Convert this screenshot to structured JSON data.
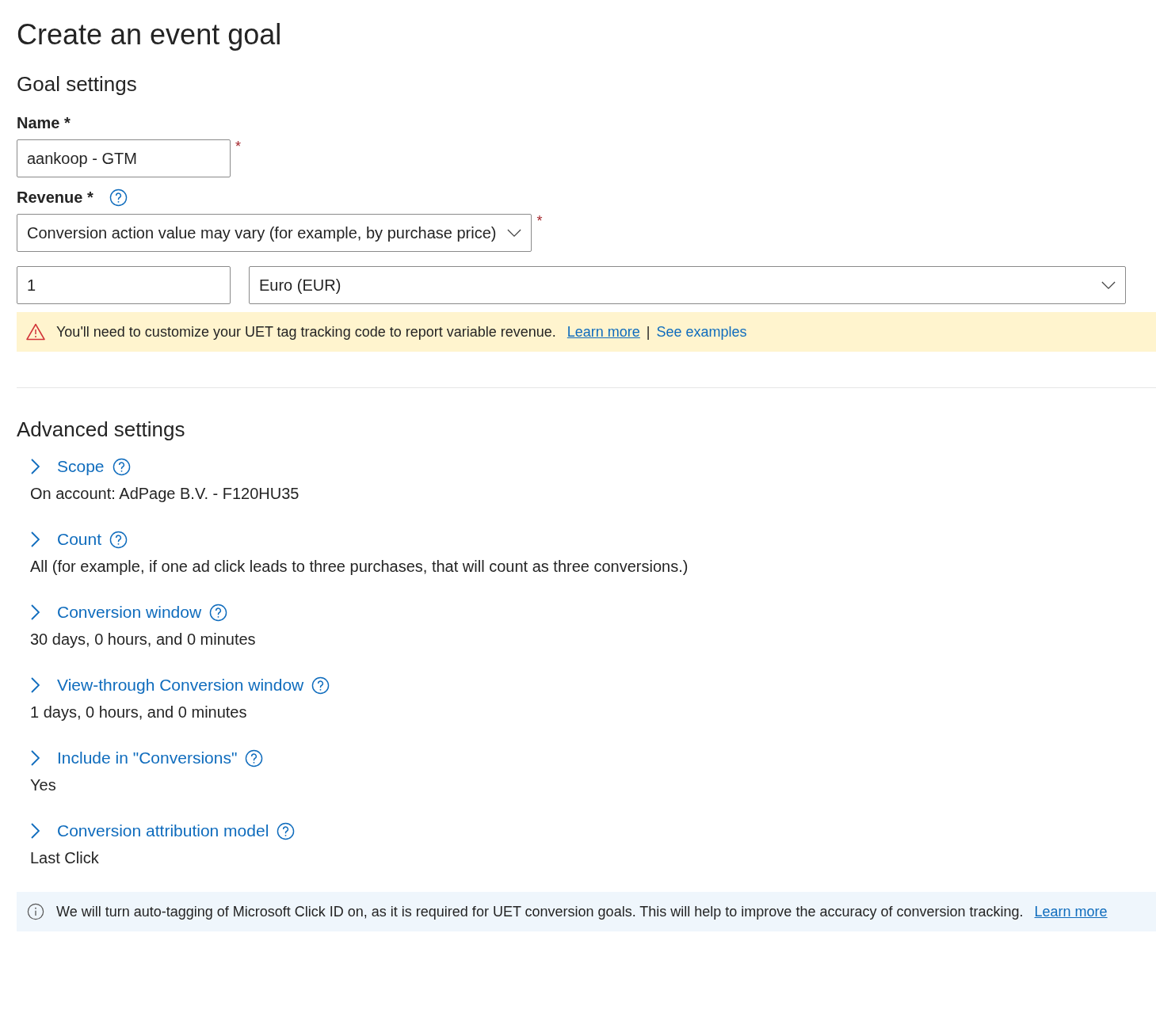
{
  "page": {
    "title": "Create an event goal"
  },
  "goal_settings": {
    "heading": "Goal settings",
    "name": {
      "label": "Name *",
      "value": "aankoop - GTM",
      "required_mark": "*"
    },
    "revenue": {
      "label": "Revenue *",
      "dropdown": {
        "value": "Conversion action value may vary (for example, by purchase price)",
        "required_mark": "*"
      },
      "amount": {
        "value": "1"
      },
      "currency": {
        "value": "Euro (EUR)"
      }
    },
    "warning": {
      "text": "You'll need to customize your UET tag tracking code to report variable revenue.",
      "links": [
        {
          "label": "Learn more",
          "underlined": true
        },
        {
          "label": "See examples",
          "underlined": false
        }
      ],
      "separator": "|"
    }
  },
  "advanced_settings": {
    "heading": "Advanced settings",
    "items": [
      {
        "label": "Scope",
        "expanded": false,
        "summary": "On account: AdPage B.V. - F120HU35"
      },
      {
        "label": "Count",
        "expanded": false,
        "summary": "All (for example, if one ad click leads to three purchases, that will count as three conversions.)"
      },
      {
        "label": "Conversion window",
        "expanded": false,
        "summary": "30 days, 0 hours, and 0 minutes"
      },
      {
        "label": "View-through Conversion window",
        "expanded": false,
        "summary": "1 days, 0 hours, and 0 minutes"
      },
      {
        "label": "Include in \"Conversions\"",
        "expanded": false,
        "summary": "Yes"
      },
      {
        "label": "Conversion attribution model",
        "expanded": false,
        "summary": "Last Click"
      }
    ]
  },
  "info_banner": {
    "text": "We will turn auto-tagging of Microsoft Click ID on, as it is required for UET conversion goals. This will help to improve the accuracy of conversion tracking.",
    "link": "Learn more"
  }
}
